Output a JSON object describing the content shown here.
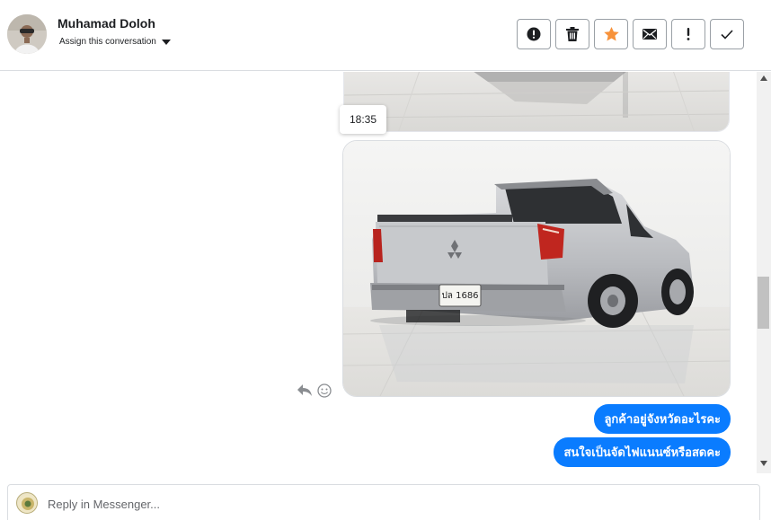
{
  "header": {
    "contact_name": "Muhamad Doloh",
    "assign_label": "Assign this conversation",
    "actions": [
      {
        "name": "spam-button",
        "icon": "alert-circle-icon"
      },
      {
        "name": "delete-button",
        "icon": "trash-icon"
      },
      {
        "name": "star-button",
        "icon": "star-icon"
      },
      {
        "name": "mark-unread-button",
        "icon": "envelope-icon"
      },
      {
        "name": "follow-up-button",
        "icon": "exclamation-icon"
      },
      {
        "name": "mark-done-button",
        "icon": "check-icon"
      }
    ]
  },
  "thread": {
    "timestamp": "18:35",
    "messages": [
      "ลูกค้าอยู่จังหวัดอะไรคะ",
      "สนใจเป็นจัดไฟแนนซ์หรือสดคะ"
    ],
    "plate_text": "ปล 1686"
  },
  "reply": {
    "placeholder": "Reply in Messenger..."
  },
  "colors": {
    "accent": "#0a7cff",
    "star": "#f7923a"
  }
}
